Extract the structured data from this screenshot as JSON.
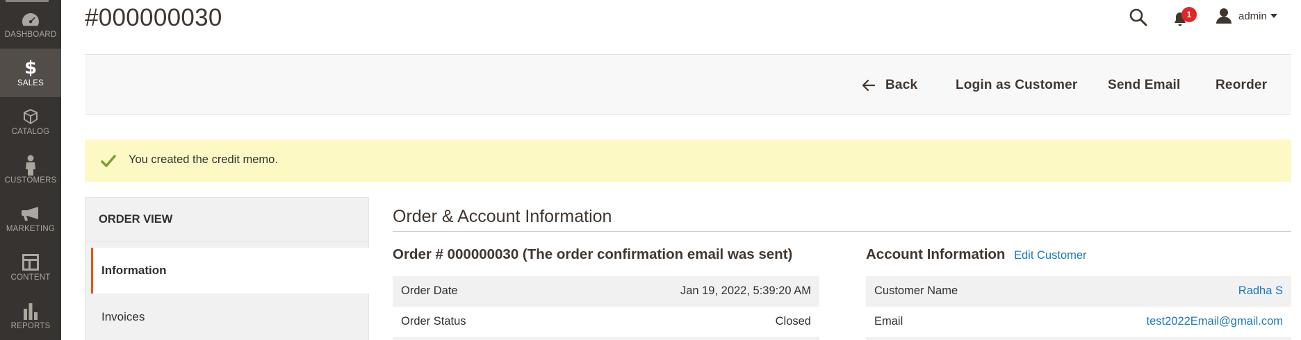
{
  "nav": {
    "items": [
      {
        "label": "DASHBOARD",
        "icon": "dashboard-icon"
      },
      {
        "label": "SALES",
        "icon": "dollar-icon",
        "glyph": "$"
      },
      {
        "label": "CATALOG",
        "icon": "cube-icon"
      },
      {
        "label": "CUSTOMERS",
        "icon": "person-icon"
      },
      {
        "label": "MARKETING",
        "icon": "megaphone-icon"
      },
      {
        "label": "CONTENT",
        "icon": "layout-icon"
      },
      {
        "label": "REPORTS",
        "icon": "bar-chart-icon"
      }
    ],
    "active": "SALES"
  },
  "header": {
    "title": "#000000030",
    "notification_count": "1",
    "user": "admin"
  },
  "actions": {
    "back": "Back",
    "login_as_customer": "Login as Customer",
    "send_email": "Send Email",
    "reorder": "Reorder"
  },
  "message": {
    "text": "You created the credit memo."
  },
  "sidebar": {
    "title": "ORDER VIEW",
    "tabs": [
      "Information",
      "Invoices"
    ]
  },
  "main": {
    "section_title": "Order & Account Information",
    "order": {
      "heading": "Order # 000000030 (The order confirmation email was sent)",
      "rows": [
        {
          "label": "Order Date",
          "value": "Jan 19, 2022, 5:39:20 AM"
        },
        {
          "label": "Order Status",
          "value": "Closed"
        }
      ]
    },
    "account": {
      "heading": "Account Information",
      "edit_link": "Edit Customer",
      "rows": [
        {
          "label": "Customer Name",
          "value": "Radha S"
        },
        {
          "label": "Email",
          "value": "test2022Email@gmail.com"
        }
      ]
    }
  },
  "colors": {
    "nav_bg": "#373330",
    "nav_active": "#524d49",
    "accent": "#eb5202",
    "link": "#1979c3",
    "success_bg": "#fdf9c5",
    "success_check": "#79a22e",
    "badge": "#e22626"
  }
}
